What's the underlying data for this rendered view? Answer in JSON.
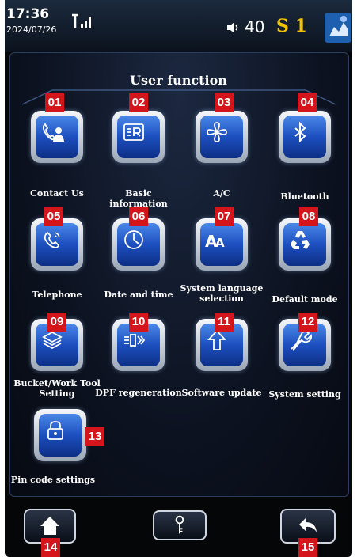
{
  "status": {
    "time": "17:36",
    "date": "2024/07/26",
    "volume": "40",
    "mode": "S 1"
  },
  "title": "User function",
  "functions": [
    {
      "badge": "01",
      "label": "Contact Us",
      "icon": "contact-icon"
    },
    {
      "badge": "02",
      "label": "Basic information",
      "icon": "id-card-icon"
    },
    {
      "badge": "03",
      "label": "A/C",
      "icon": "fan-icon"
    },
    {
      "badge": "04",
      "label": "Bluetooth",
      "icon": "bluetooth-icon"
    },
    {
      "badge": "05",
      "label": "Telephone",
      "icon": "phone-icon"
    },
    {
      "badge": "06",
      "label": "Date and time",
      "icon": "clock-icon"
    },
    {
      "badge": "07",
      "label": "System language selection",
      "icon": "language-icon"
    },
    {
      "badge": "08",
      "label": "Default mode",
      "icon": "recycle-icon"
    },
    {
      "badge": "09",
      "label": "Bucket/Work Tool Setting",
      "icon": "layers-icon"
    },
    {
      "badge": "10",
      "label": "DPF regeneration",
      "icon": "dpf-icon"
    },
    {
      "badge": "11",
      "label": "Software update",
      "icon": "upload-arrow-icon"
    },
    {
      "badge": "12",
      "label": "System setting",
      "icon": "wrench-icon"
    },
    {
      "badge": "13",
      "label": "Pin code settings",
      "icon": "lock-icon"
    }
  ],
  "nav": {
    "home_badge": "14",
    "back_badge": "15"
  },
  "colors": {
    "badge": "#d4161c",
    "accent_yellow": "#f4c400",
    "tile_blue": "#1d4fbf"
  }
}
